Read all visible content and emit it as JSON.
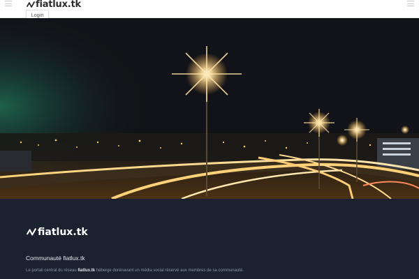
{
  "header": {
    "brand_name": "fiatlux.tk",
    "login_label": "Login",
    "menu_left_icon": "hamburger-menu-icon",
    "menu_right_icon": "hamburger-menu-icon"
  },
  "hero": {
    "image": "night-city-highway-lights"
  },
  "footer": {
    "brand_name": "fiatlux.tk",
    "title": "Communauté fiatlux.tk",
    "desc_before": "Le portail central du réseau ",
    "desc_bold": "fiatlux.tk",
    "desc_after": " héberge dorénavant un média social réservé aux membres de sa communauté."
  },
  "colors": {
    "footer_bg": "#1a2230",
    "header_bg": "#ffffff",
    "light_glow": "#ffc766"
  }
}
